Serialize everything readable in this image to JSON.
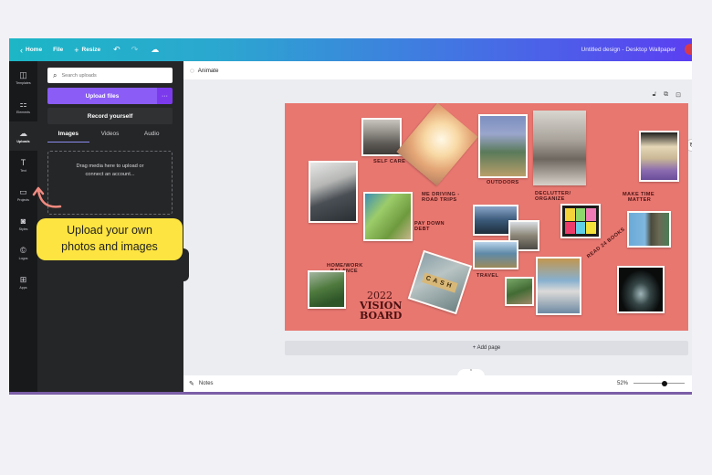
{
  "topbar": {
    "home_label": "Home",
    "file_label": "File",
    "resize_label": "Resize",
    "document_title": "Untitled design - Desktop Wallpaper",
    "icons": {
      "back": "chevron-left-icon",
      "resize": "plus-icon",
      "undo": "undo-icon",
      "redo": "redo-icon",
      "save": "cloud-icon"
    }
  },
  "rail": {
    "items": [
      {
        "label": "Templates",
        "icon": "layout-icon",
        "glyph": "◫"
      },
      {
        "label": "Elements",
        "icon": "shapes-icon",
        "glyph": "⚏"
      },
      {
        "label": "Uploads",
        "icon": "upload-cloud-icon",
        "glyph": "☁"
      },
      {
        "label": "Text",
        "icon": "text-icon",
        "glyph": "T"
      },
      {
        "label": "Projects",
        "icon": "folder-icon",
        "glyph": "▭"
      },
      {
        "label": "Styles",
        "icon": "palette-icon",
        "glyph": "◙"
      },
      {
        "label": "Logos",
        "icon": "logo-icon",
        "glyph": "©"
      },
      {
        "label": "Apps",
        "icon": "apps-grid-icon",
        "glyph": "⊞"
      }
    ],
    "active_index": 2
  },
  "panel": {
    "search_placeholder": "Search uploads",
    "upload_button": "Upload files",
    "more_button": "···",
    "record_button": "Record yourself",
    "tabs": [
      "Images",
      "Videos",
      "Audio"
    ],
    "active_tab": "Images",
    "dropzone_text_1": "Drag media here to upload or",
    "dropzone_text_2": "connect an account..."
  },
  "callout": {
    "line1": "Upload your own",
    "line2": "photos and images",
    "color": "#fee440"
  },
  "workspace": {
    "animate_label": "Animate",
    "add_page_label": "+ Add page",
    "notes_label": "Notes",
    "zoom_level": "52%",
    "zoom_slider_fraction": 0.6
  },
  "canvas": {
    "background": "#e87770",
    "title_lines": [
      "2022",
      "VISION",
      "BOARD"
    ],
    "labels": {
      "self_care": "SELF CARE",
      "me_driving": "ME DRIVING -\nROAD TRIPS",
      "outdoors": "OUTDOORS",
      "declutter": "DECLUTTER/\nORGANIZE",
      "make_time": "MAKE TIME\n   MATTER",
      "pay_down": "PAY DOWN\nDEBT",
      "home_work": "HOME/WORK\n  BALANCE",
      "travel": "TRAVEL",
      "read_books": "READ 24 BOOKS",
      "cash": "CASH"
    }
  }
}
